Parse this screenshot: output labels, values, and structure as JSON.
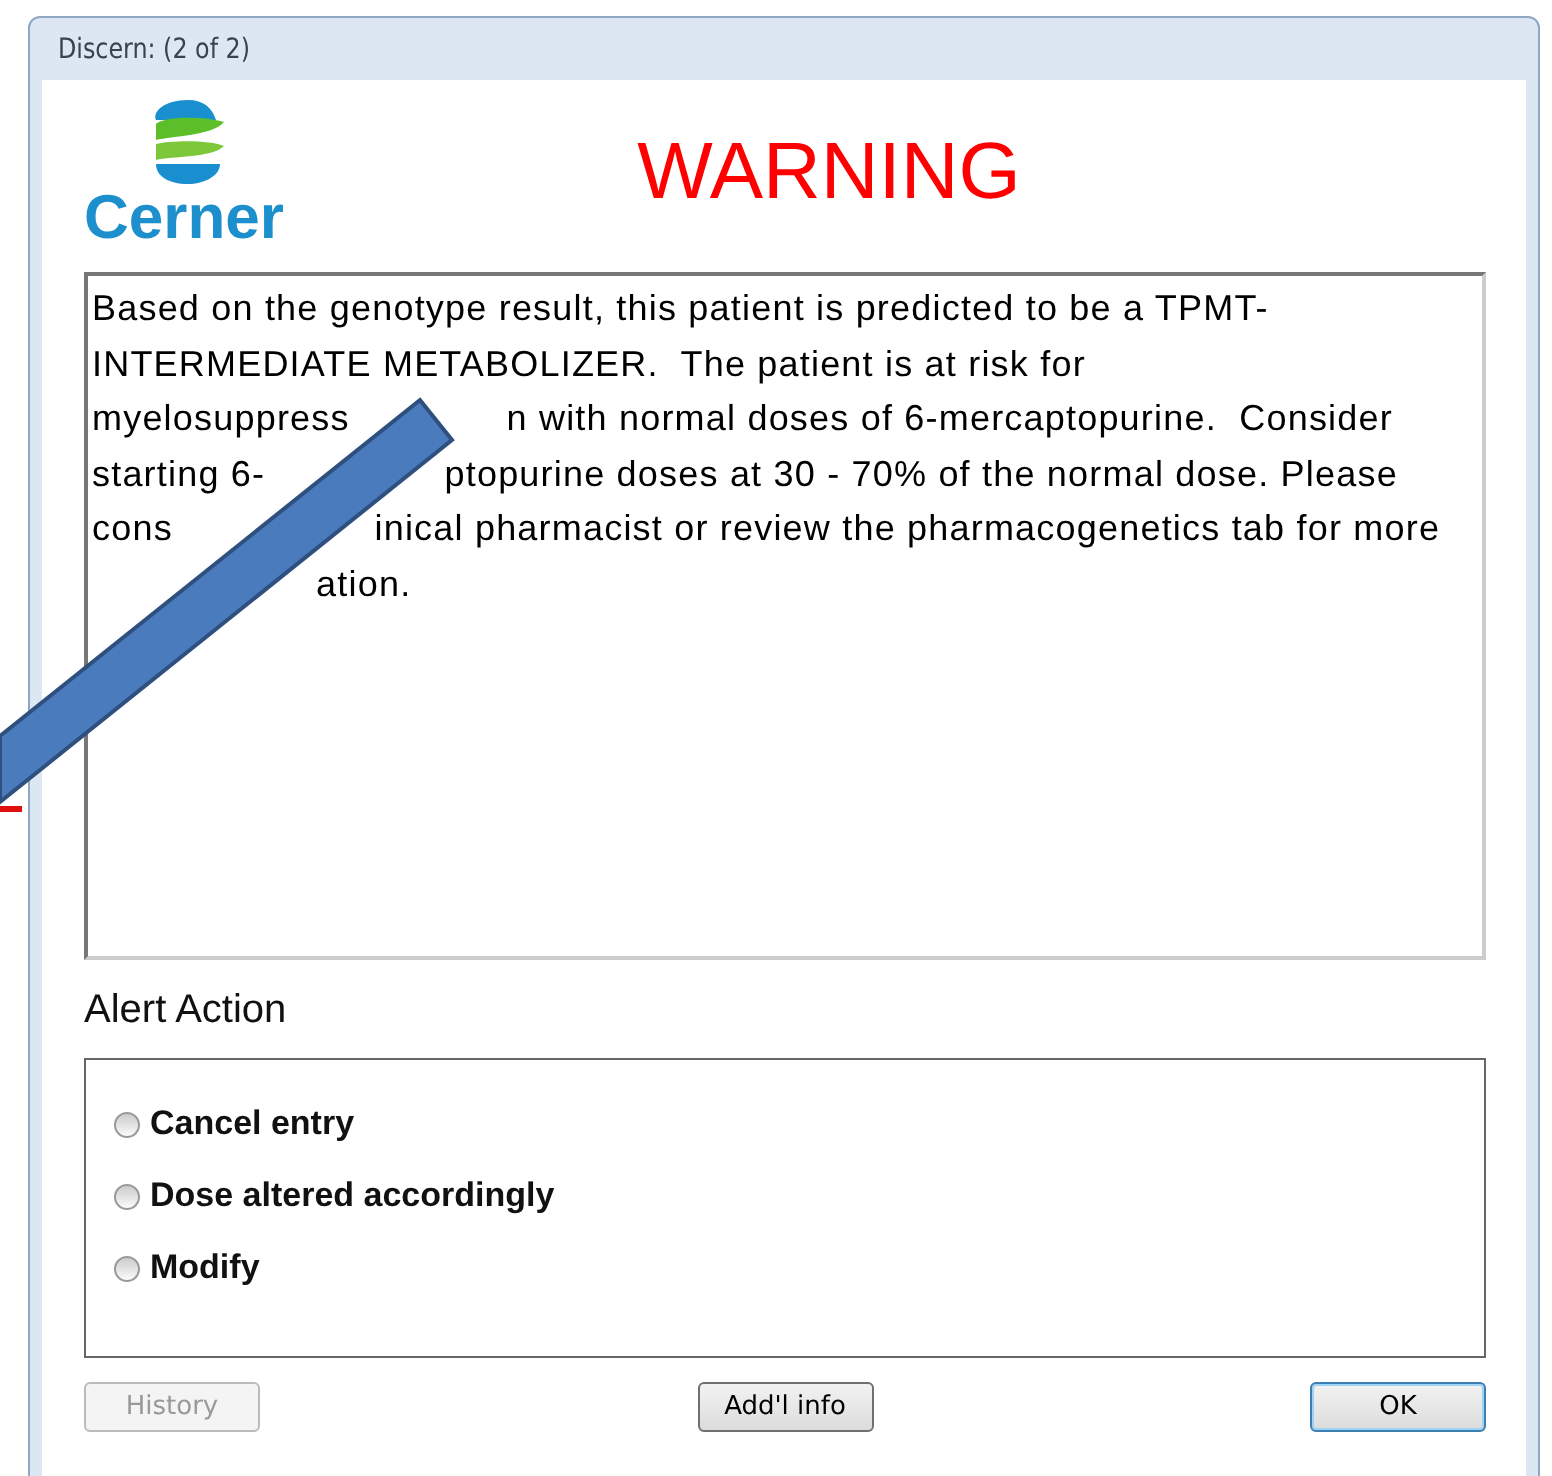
{
  "window": {
    "title": "Discern: (2 of 2)"
  },
  "logo": {
    "text": "Cerner"
  },
  "heading": "WARNING",
  "message": "Based on the genotype result, this patient is predicted to be a TPMT-\nINTERMEDIATE METABOLIZER.  The patient is at risk for\nmyelosuppress              n with normal doses of 6-mercaptopurine.  Consider\nstarting 6-                ptopurine doses at 30 - 70% of the normal dose. Please\ncons                  inical pharmacist or review the pharmacogenetics tab for more\n                    ation.",
  "alert_action": {
    "label": "Alert Action",
    "options": [
      {
        "label": "Cancel entry",
        "selected": false
      },
      {
        "label": "Dose altered accordingly",
        "selected": false
      },
      {
        "label": "Modify",
        "selected": false
      }
    ]
  },
  "buttons": [
    {
      "label": "History",
      "disabled": true,
      "default": false
    },
    {
      "label": "Add'l info",
      "disabled": false,
      "default": false
    },
    {
      "label": "OK",
      "disabled": false,
      "default": true
    }
  ]
}
